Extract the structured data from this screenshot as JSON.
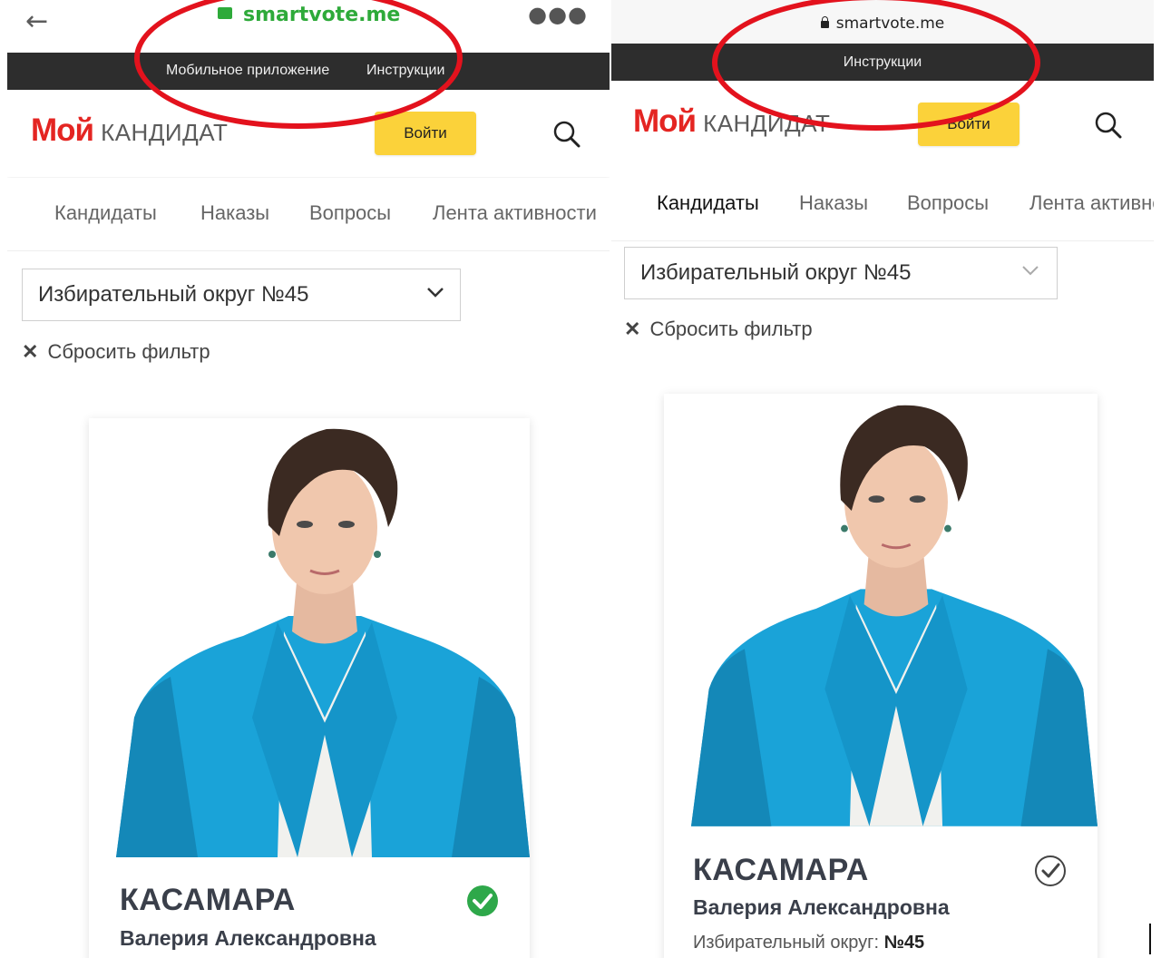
{
  "left": {
    "url": "smartvote.me",
    "strip_links": [
      "Мобильное приложение",
      "Инструкции"
    ],
    "logo_main": "Мой",
    "logo_sub": "КАНДИДАТ",
    "login_label": "Войти",
    "tabs": [
      "Кандидаты",
      "Наказы",
      "Вопросы",
      "Лента активности"
    ],
    "district_select": "Избирательный округ №45",
    "reset_filter": "Сбросить фильтр",
    "card": {
      "surname": "КАСАМАРА",
      "name": "Валерия Александровна",
      "check_color": "#2ea84a"
    }
  },
  "right": {
    "url": "smartvote.me",
    "strip_links": [
      "Инструкции"
    ],
    "logo_main": "Мой",
    "logo_sub": "КАНДИДАТ",
    "login_label": "Войти",
    "tabs": [
      "Кандидаты",
      "Наказы",
      "Вопросы",
      "Лента активности"
    ],
    "district_select": "Избирательный округ №45",
    "reset_filter": "Сбросить фильтр",
    "card": {
      "surname": "КАСАМАРА",
      "name": "Валерия Александровна",
      "district_label": "Избирательный округ:",
      "district_value": "№45"
    }
  },
  "colors": {
    "accent_yellow": "#fbd23a",
    "logo_red": "#e42522",
    "annotation_red": "#e3121d",
    "jacket_blue": "#1aa3d8"
  }
}
